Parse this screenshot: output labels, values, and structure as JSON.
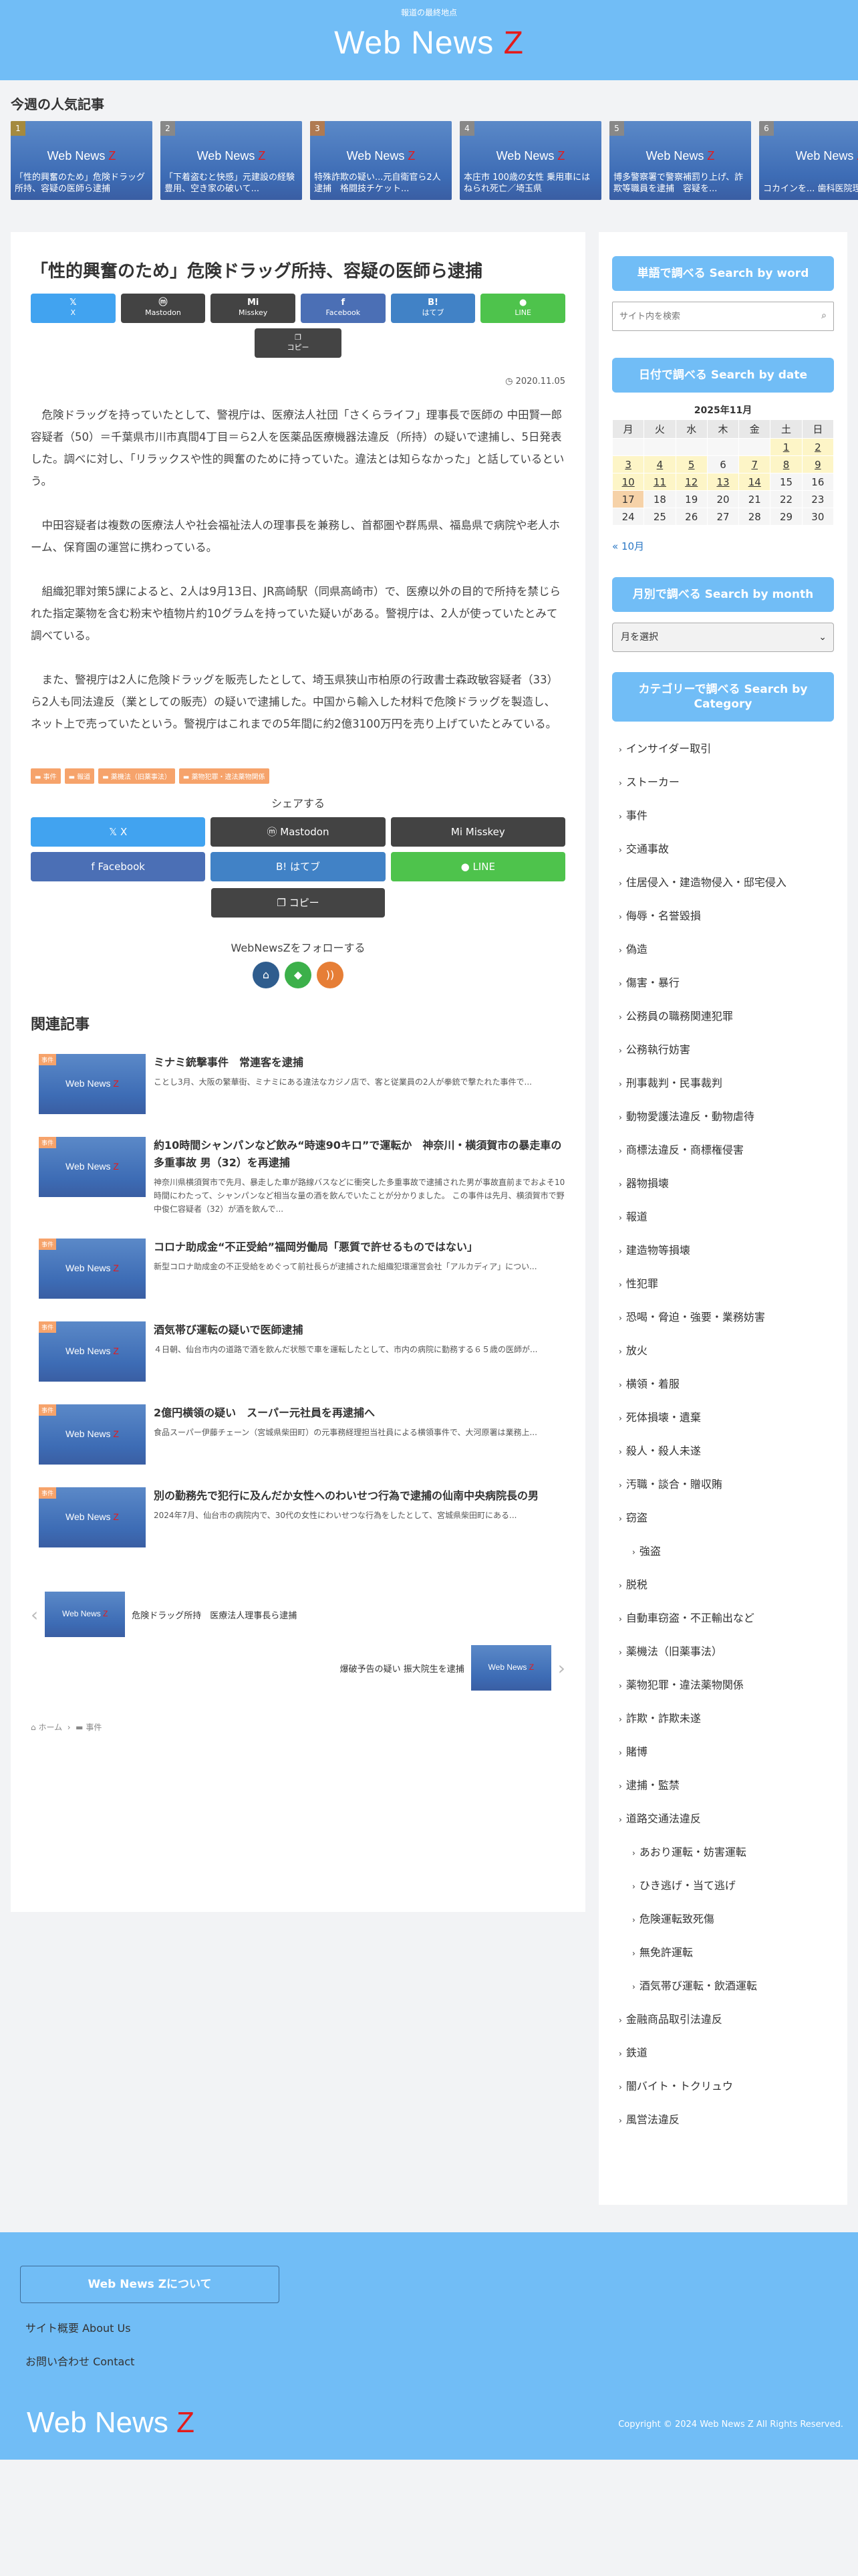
{
  "header": {
    "description": "報道の最終地点",
    "logo_main": "Web News ",
    "logo_z": "Z"
  },
  "popular": {
    "title": "今週の人気記事",
    "items": [
      {
        "rank": "1",
        "title": "「性的興奮のため」危険ドラッグ所持、容疑の医師ら逮捕"
      },
      {
        "rank": "2",
        "title": "「下着盗むと快感」元建設の経験豊用、空き家の破いて..."
      },
      {
        "rank": "3",
        "title": "特殊詐欺の疑い...元自衛官ら2人逮捕　格闘技チケット..."
      },
      {
        "rank": "4",
        "title": "本庄市 100歳の女性 乗用車にはねられ死亡／埼玉県"
      },
      {
        "rank": "5",
        "title": "博多警察署で警察補罰り上げ、詐欺等職員を逮捕　容疑を..."
      },
      {
        "rank": "6",
        "title": "コカインを... 歯科医院理容長の..."
      }
    ]
  },
  "article": {
    "title": "「性的興奮のため」危険ドラッグ所持、容疑の医師ら逮捕",
    "share": {
      "x": "X",
      "mastodon": "Mastodon",
      "misskey": "Misskey",
      "facebook": "Facebook",
      "hatena": "はてブ",
      "line": "LINE",
      "copy": "コピー"
    },
    "date": "2020.11.05",
    "paragraphs": [
      "危険ドラッグを持っていたとして、警視庁は、医療法人社団「さくらライフ」理事長で医師の 中田賢一郎 容疑者（50）＝千葉県市川市真間4丁目＝ら2人を医薬品医療機器法違反（所持）の疑いで逮捕し、5日発表した。調べに対し、「リラックスや性的興奮のために持っていた。違法とは知らなかった」と話しているという。",
      "中田容疑者は複数の医療法人や社会福祉法人の理事長を兼務し、首都圏や群馬県、福島県で病院や老人ホーム、保育園の運営に携わっている。",
      "組織犯罪対策5課によると、2人は9月13日、JR高崎駅（同県高崎市）で、医療以外の目的で所持を禁じられた指定薬物を含む粉末や植物片約10グラムを持っていた疑いがある。警視庁は、2人が使っていたとみて調べている。",
      "また、警視庁は2人に危険ドラッグを販売したとして、埼玉県狭山市柏原の行政書士森政敏容疑者（33）ら2人も同法違反（業としての販売）の疑いで逮捕した。中国から輸入した材料で危険ドラッグを製造し、ネット上で売っていたという。警視庁はこれまでの5年間に約2億3100万円を売り上げていたとみている。"
    ],
    "tags": [
      "事件",
      "報道",
      "薬機法（旧薬事法）",
      "薬物犯罪・違法薬物関係"
    ],
    "share_bottom_title": "シェアする",
    "follow_title": "WebNewsZをフォローする",
    "related_title": "関連記事",
    "related_cat": "事件",
    "related": [
      {
        "title": "ミナミ銃撃事件　常連客を逮捕",
        "excerpt": "ことし3月、大阪の繁華街、ミナミにある違法なカジノ店で、客と従業員の2人が拳銃で撃たれた事件で..."
      },
      {
        "title": "約10時間シャンパンなど飲み“時速90キロ”で運転か　神奈川・横須賀市の暴走車の多重事故 男（32）を再逮捕",
        "excerpt": "神奈川県横須賀市で先月、暴走した車が路線バスなどに衝突した多重事故で逮捕された男が事故直前までおよそ10時間にわたって、シャンパンなど相当な量の酒を飲んでいたことが分かりました。 この事件は先月、横須賀市で野中俊仁容疑者（32）が酒を飲んで..."
      },
      {
        "title": "コロナ助成金“不正受給”福岡労働局「悪質で許せるものではない」",
        "excerpt": "新型コロナ助成金の不正受給をめぐって前社長らが逮捕された組織犯環運営会社「アルカディア」につい..."
      },
      {
        "title": "酒気帯び運転の疑いで医師逮捕",
        "excerpt": "４日朝、仙台市内の道路で酒を飲んだ状態で車を運転したとして、市内の病院に勤務する６５歳の医師が..."
      },
      {
        "title": "2億円横領の疑い　スーパー元社員を再逮捕へ",
        "excerpt": "食品スーパー伊藤チェーン（宮城県柴田町）の元事務経理担当社員による横領事件で、大河原署は業務上..."
      },
      {
        "title": "別の勤務先で犯行に及んだか女性へのわいせつ行為で逮捕の仙南中央病院長の男",
        "excerpt": "2024年7月、仙台市の病院内で、30代の女性にわいせつな行為をしたとして、宮城県柴田町にある..."
      }
    ],
    "prev_title": "危険ドラッグ所持　医療法人理事長ら逮捕",
    "next_title": "爆破予告の疑い 振大院生を逮捕",
    "breadcrumb_home": "ホーム",
    "breadcrumb_cat": "事件"
  },
  "sidebar": {
    "search_title": "単語で調べる Search by word",
    "search_placeholder": "サイト内を検索",
    "date_title": "日付で調べる Search by date",
    "calendar": {
      "caption": "2025年11月",
      "weekdays": [
        "月",
        "火",
        "水",
        "木",
        "金",
        "土",
        "日"
      ],
      "rows": [
        [
          "",
          "",
          "",
          "",
          "",
          "1",
          "2"
        ],
        [
          "3",
          "4",
          "5",
          "6",
          "7",
          "8",
          "9"
        ],
        [
          "10",
          "11",
          "12",
          "13",
          "14",
          "15",
          "16"
        ],
        [
          "17",
          "18",
          "19",
          "20",
          "21",
          "22",
          "23"
        ],
        [
          "24",
          "25",
          "26",
          "27",
          "28",
          "29",
          "30"
        ]
      ],
      "prev": "« 10月"
    },
    "month_title": "月別で調べる Search by month",
    "month_select": "月を選択",
    "category_title": "カテゴリーで調べる Search by Category",
    "categories": [
      {
        "label": "インサイダー取引",
        "sub": false
      },
      {
        "label": "ストーカー",
        "sub": false
      },
      {
        "label": "事件",
        "sub": false
      },
      {
        "label": "交通事故",
        "sub": false
      },
      {
        "label": "住居侵入・建造物侵入・邸宅侵入",
        "sub": false
      },
      {
        "label": "侮辱・名誉毀損",
        "sub": false
      },
      {
        "label": "偽造",
        "sub": false
      },
      {
        "label": "傷害・暴行",
        "sub": false
      },
      {
        "label": "公務員の職務関連犯罪",
        "sub": false
      },
      {
        "label": "公務執行妨害",
        "sub": false
      },
      {
        "label": "刑事裁判・民事裁判",
        "sub": false
      },
      {
        "label": "動物愛護法違反・動物虐待",
        "sub": false
      },
      {
        "label": "商標法違反・商標権侵害",
        "sub": false
      },
      {
        "label": "器物損壊",
        "sub": false
      },
      {
        "label": "報道",
        "sub": false
      },
      {
        "label": "建造物等損壊",
        "sub": false
      },
      {
        "label": "性犯罪",
        "sub": false
      },
      {
        "label": "恐喝・脅迫・強要・業務妨害",
        "sub": false
      },
      {
        "label": "放火",
        "sub": false
      },
      {
        "label": "横領・着服",
        "sub": false
      },
      {
        "label": "死体損壊・遺棄",
        "sub": false
      },
      {
        "label": "殺人・殺人未遂",
        "sub": false
      },
      {
        "label": "汚職・談合・贈収賄",
        "sub": false
      },
      {
        "label": "窃盗",
        "sub": false
      },
      {
        "label": "強盗",
        "sub": true
      },
      {
        "label": "脱税",
        "sub": false
      },
      {
        "label": "自動車窃盗・不正輸出など",
        "sub": false
      },
      {
        "label": "薬機法（旧薬事法）",
        "sub": false
      },
      {
        "label": "薬物犯罪・違法薬物関係",
        "sub": false
      },
      {
        "label": "詐欺・詐欺未遂",
        "sub": false
      },
      {
        "label": "賭博",
        "sub": false
      },
      {
        "label": "逮捕・監禁",
        "sub": false
      },
      {
        "label": "道路交通法違反",
        "sub": false
      },
      {
        "label": "あおり運転・妨害運転",
        "sub": true
      },
      {
        "label": "ひき逃げ・当て逃げ",
        "sub": true
      },
      {
        "label": "危険運転致死傷",
        "sub": true
      },
      {
        "label": "無免許運転",
        "sub": true
      },
      {
        "label": "酒気帯び運転・飲酒運転",
        "sub": true
      },
      {
        "label": "金融商品取引法違反",
        "sub": false
      },
      {
        "label": "鉄道",
        "sub": false
      },
      {
        "label": "闇バイト・トクリュウ",
        "sub": false
      },
      {
        "label": "風営法違反",
        "sub": false
      }
    ]
  },
  "footer": {
    "about": "Web News Zについて",
    "links": [
      "サイト概要 About Us",
      "お問い合わせ Contact"
    ],
    "logo_main": "Web News ",
    "logo_z": "Z",
    "copyright": "Copyright © 2024 Web News Z All Rights Reserved."
  },
  "colors": {
    "accent": "#71bdf6",
    "logo_z": "#e41b1b",
    "tag": "#f6a36b"
  }
}
